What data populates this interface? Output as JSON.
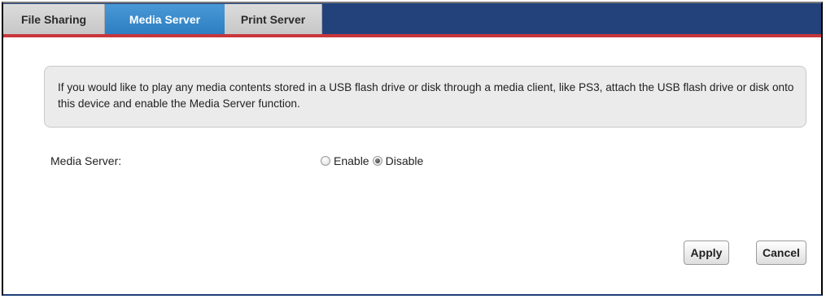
{
  "tabs": [
    {
      "label": "File Sharing",
      "active": false
    },
    {
      "label": "Media Server",
      "active": true
    },
    {
      "label": "Print Server",
      "active": false
    }
  ],
  "info": {
    "text": "If you would like to play any media contents stored in a USB flash drive or disk through a media client, like PS3, attach the USB flash drive or disk onto this device and enable the Media Server function."
  },
  "media_server": {
    "label": "Media Server:",
    "options": [
      "Enable",
      "Disable"
    ],
    "selected": "Disable"
  },
  "buttons": {
    "apply": "Apply",
    "cancel": "Cancel"
  },
  "colors": {
    "tabbar": "#23427c",
    "active_tab": "#2c7fc2",
    "accent_line": "#c8363b",
    "info_bg": "#ebebeb"
  }
}
